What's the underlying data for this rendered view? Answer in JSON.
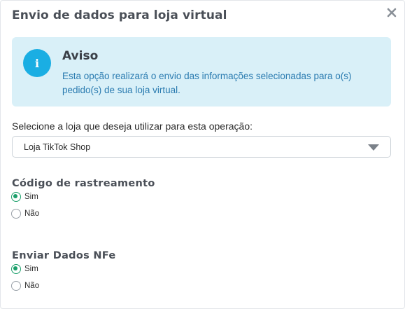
{
  "modal": {
    "title": "Envio de dados para loja virtual",
    "close_icon": "close-icon"
  },
  "alert": {
    "icon": "info-icon",
    "icon_glyph": "i",
    "title": "Aviso",
    "text": "Esta opção realizará o envio das informações selecionadas para o(s) pedido(s) de sua loja virtual.",
    "background": "#d9f0f8",
    "accent": "#1aaee3"
  },
  "store_select": {
    "label": "Selecione a loja que deseja utilizar para esta operação:",
    "value": "Loja TikTok Shop",
    "caret_icon": "caret-down-icon"
  },
  "tracking": {
    "title": "Código de rastreamento",
    "options": [
      {
        "label": "Sim",
        "checked": true
      },
      {
        "label": "Não",
        "checked": false
      }
    ]
  },
  "nfe": {
    "title": "Enviar Dados NFe",
    "options": [
      {
        "label": "Sim",
        "checked": true
      },
      {
        "label": "Não",
        "checked": false
      }
    ]
  },
  "colors": {
    "radio_checked": "#1a9f6a",
    "title_text": "#4a4f57",
    "alert_text": "#2a7bb0"
  }
}
